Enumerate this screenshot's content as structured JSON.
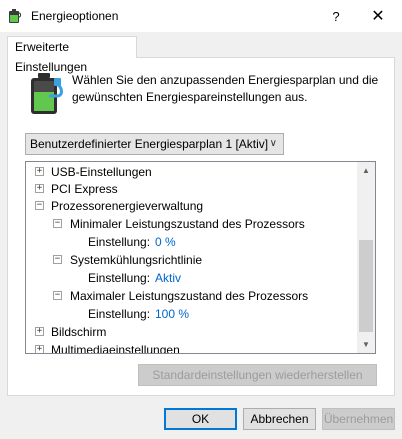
{
  "window": {
    "title": "Energieoptionen",
    "help_label": "?",
    "close_label": "✕"
  },
  "tab": {
    "label": "Erweiterte Einstellungen"
  },
  "header": {
    "line1": "Wählen Sie den anzupassenden Energiesparplan und die",
    "line2": "gewünschten Energiespareinstellungen aus."
  },
  "plan_select": {
    "value": "Benutzerdefinierter Energiesparplan 1 [Aktiv]",
    "chevron": "∨"
  },
  "tree": {
    "items": [
      {
        "expander": "+",
        "label": "USB-Einstellungen"
      },
      {
        "expander": "+",
        "label": "PCI Express"
      },
      {
        "expander": "−",
        "label": "Prozessorenergieverwaltung"
      },
      {
        "expander": "−",
        "label": "Minimaler Leistungszustand des Prozessors"
      },
      {
        "setting_label": "Einstellung:",
        "value": "0 %"
      },
      {
        "expander": "−",
        "label": "Systemkühlungsrichtlinie"
      },
      {
        "setting_label": "Einstellung:",
        "value": "Aktiv"
      },
      {
        "expander": "−",
        "label": "Maximaler Leistungszustand des Prozessors"
      },
      {
        "setting_label": "Einstellung:",
        "value": "100 %"
      },
      {
        "expander": "+",
        "label": "Bildschirm"
      },
      {
        "expander": "+",
        "label": "Multimediaeinstellungen"
      }
    ]
  },
  "scrollbar": {
    "up": "▲",
    "down": "▼"
  },
  "buttons": {
    "restore": "Standardeinstellungen wiederherstellen",
    "ok": "OK",
    "cancel": "Abbrechen",
    "apply": "Übernehmen"
  },
  "colors": {
    "value_link": "#0066cc",
    "accent": "#0078d7"
  },
  "icons": {
    "title": "battery-plug-icon",
    "header": "battery-plug-icon"
  }
}
